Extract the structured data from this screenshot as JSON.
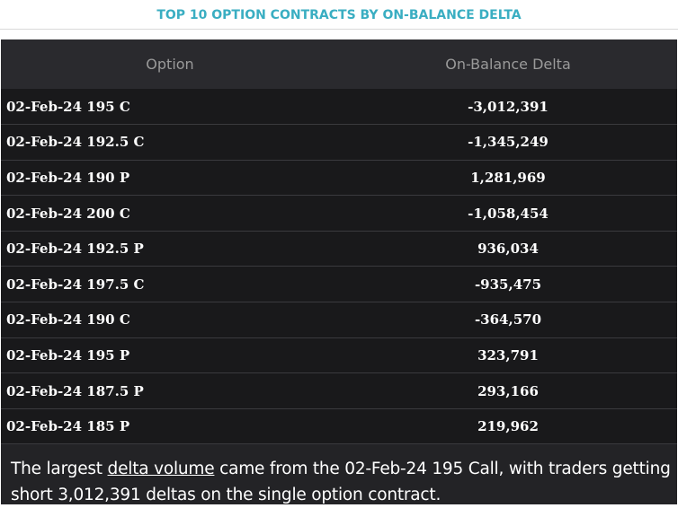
{
  "header": {
    "title": "TOP 10 OPTION CONTRACTS BY ON-BALANCE DELTA"
  },
  "table": {
    "columns": [
      "Option",
      "On-Balance Delta"
    ],
    "rows": [
      {
        "option": "02-Feb-24 195 C",
        "delta": "-3,012,391"
      },
      {
        "option": "02-Feb-24 192.5 C",
        "delta": "-1,345,249"
      },
      {
        "option": "02-Feb-24 190 P",
        "delta": "1,281,969"
      },
      {
        "option": "02-Feb-24 200 C",
        "delta": "-1,058,454"
      },
      {
        "option": "02-Feb-24 192.5 P",
        "delta": "936,034"
      },
      {
        "option": "02-Feb-24 197.5 C",
        "delta": "-935,475"
      },
      {
        "option": "02-Feb-24 190 C",
        "delta": "-364,570"
      },
      {
        "option": "02-Feb-24 195 P",
        "delta": "323,791"
      },
      {
        "option": "02-Feb-24 187.5 P",
        "delta": "293,166"
      },
      {
        "option": "02-Feb-24 185 P",
        "delta": "219,962"
      }
    ]
  },
  "summary": {
    "prefix": "The largest ",
    "link_text": "delta volume",
    "suffix": " came from the 02-Feb-24 195 Call, with traders getting short 3,012,391 deltas on the single option contract."
  },
  "colors": {
    "title": "#3aaec2",
    "table_background": "#19191b",
    "header_background": "#2a2a2e",
    "header_text": "#9a9a9a",
    "cell_text": "#ffffff"
  }
}
